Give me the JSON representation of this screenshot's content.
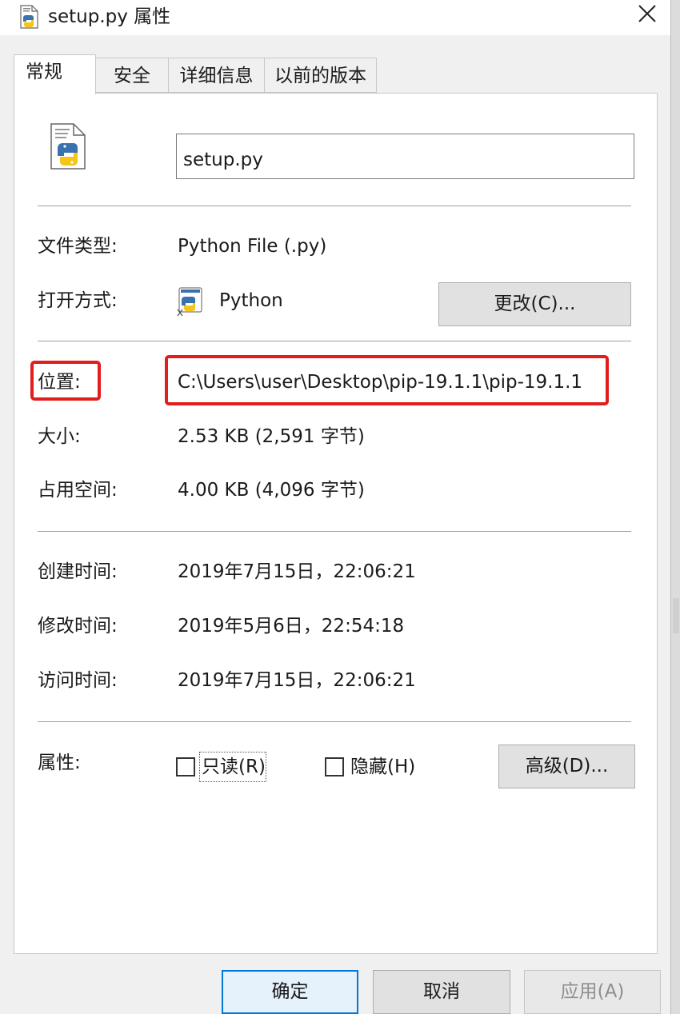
{
  "window": {
    "title": "setup.py 属性"
  },
  "tabs": [
    "常规",
    "安全",
    "详细信息",
    "以前的版本"
  ],
  "file": {
    "name": "setup.py"
  },
  "properties": {
    "type_label": "文件类型:",
    "type_value": "Python File (.py)",
    "open_with_label": "打开方式:",
    "open_with_value": "Python",
    "change_button": "更改(C)...",
    "location_label": "位置:",
    "location_value": "C:\\Users\\user\\Desktop\\pip-19.1.1\\pip-19.1.1",
    "size_label": "大小:",
    "size_value": "2.53 KB (2,591 字节)",
    "size_on_disk_label": "占用空间:",
    "size_on_disk_value": "4.00 KB (4,096 字节)",
    "created_label": "创建时间:",
    "created_value": "2019年7月15日，22:06:21",
    "modified_label": "修改时间:",
    "modified_value": "2019年5月6日，22:54:18",
    "accessed_label": "访问时间:",
    "accessed_value": "2019年7月15日，22:06:21"
  },
  "attributes": {
    "label": "属性:",
    "readonly_label": "只读(R)",
    "readonly_checked": false,
    "hidden_label": "隐藏(H)",
    "hidden_checked": false,
    "advanced_button": "高级(D)..."
  },
  "footer": {
    "ok": "确定",
    "cancel": "取消",
    "apply": "应用(A)"
  },
  "colors": {
    "highlight": "#e31c1c",
    "focus_border": "#0078d7"
  }
}
